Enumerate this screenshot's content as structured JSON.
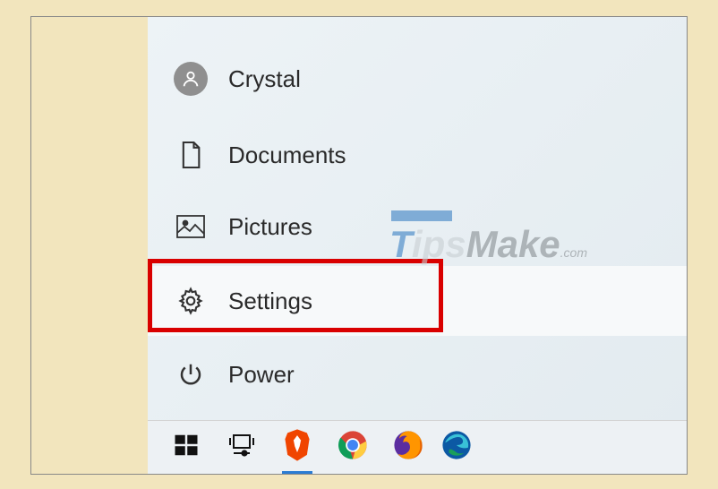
{
  "startMenu": {
    "user": {
      "name": "Crystal"
    },
    "items": [
      {
        "label": "Documents",
        "icon": "document-icon"
      },
      {
        "label": "Pictures",
        "icon": "pictures-icon"
      },
      {
        "label": "Settings",
        "icon": "gear-icon",
        "highlighted": true
      },
      {
        "label": "Power",
        "icon": "power-icon"
      }
    ]
  },
  "taskbar": {
    "items": [
      {
        "name": "start-button",
        "icon": "windows-icon"
      },
      {
        "name": "task-view-button",
        "icon": "task-view-icon"
      },
      {
        "name": "brave-app",
        "icon": "brave-icon",
        "active": true
      },
      {
        "name": "chrome-app",
        "icon": "chrome-icon"
      },
      {
        "name": "firefox-app",
        "icon": "firefox-icon"
      },
      {
        "name": "edge-app",
        "icon": "edge-icon"
      }
    ]
  },
  "watermark": {
    "prefix": "T",
    "mid": "ips",
    "suffix": "Make",
    "tld": ".com"
  },
  "highlight": {
    "target": "settings"
  }
}
